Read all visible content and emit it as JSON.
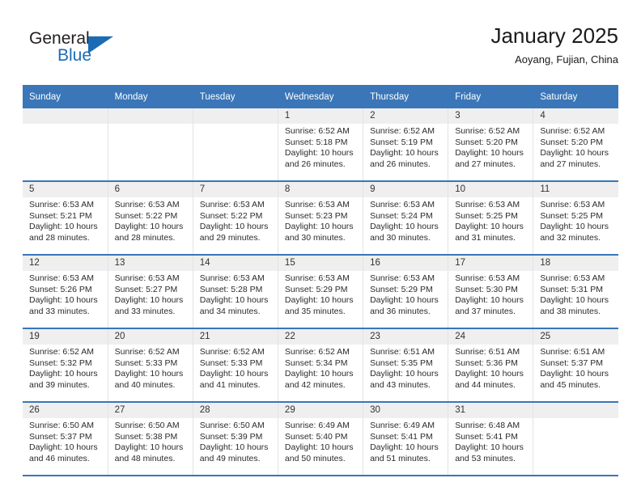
{
  "brand": {
    "name_part1": "General",
    "name_part2": "Blue",
    "triangle_icon": "triangle-icon",
    "accent_color": "#1b6cb5"
  },
  "header": {
    "title": "January 2025",
    "location": "Aoyang, Fujian, China"
  },
  "theme": {
    "header_blue": "#3a76b8",
    "daynum_band": "#efefef",
    "text": "#2b2b2b"
  },
  "weekdays": [
    "Sunday",
    "Monday",
    "Tuesday",
    "Wednesday",
    "Thursday",
    "Friday",
    "Saturday"
  ],
  "weeks": [
    [
      {
        "day": "",
        "empty": true
      },
      {
        "day": "",
        "empty": true
      },
      {
        "day": "",
        "empty": true
      },
      {
        "day": "1",
        "sunrise": "Sunrise: 6:52 AM",
        "sunset": "Sunset: 5:18 PM",
        "daylight1": "Daylight: 10 hours",
        "daylight2": "and 26 minutes."
      },
      {
        "day": "2",
        "sunrise": "Sunrise: 6:52 AM",
        "sunset": "Sunset: 5:19 PM",
        "daylight1": "Daylight: 10 hours",
        "daylight2": "and 26 minutes."
      },
      {
        "day": "3",
        "sunrise": "Sunrise: 6:52 AM",
        "sunset": "Sunset: 5:20 PM",
        "daylight1": "Daylight: 10 hours",
        "daylight2": "and 27 minutes."
      },
      {
        "day": "4",
        "sunrise": "Sunrise: 6:52 AM",
        "sunset": "Sunset: 5:20 PM",
        "daylight1": "Daylight: 10 hours",
        "daylight2": "and 27 minutes."
      }
    ],
    [
      {
        "day": "5",
        "sunrise": "Sunrise: 6:53 AM",
        "sunset": "Sunset: 5:21 PM",
        "daylight1": "Daylight: 10 hours",
        "daylight2": "and 28 minutes."
      },
      {
        "day": "6",
        "sunrise": "Sunrise: 6:53 AM",
        "sunset": "Sunset: 5:22 PM",
        "daylight1": "Daylight: 10 hours",
        "daylight2": "and 28 minutes."
      },
      {
        "day": "7",
        "sunrise": "Sunrise: 6:53 AM",
        "sunset": "Sunset: 5:22 PM",
        "daylight1": "Daylight: 10 hours",
        "daylight2": "and 29 minutes."
      },
      {
        "day": "8",
        "sunrise": "Sunrise: 6:53 AM",
        "sunset": "Sunset: 5:23 PM",
        "daylight1": "Daylight: 10 hours",
        "daylight2": "and 30 minutes."
      },
      {
        "day": "9",
        "sunrise": "Sunrise: 6:53 AM",
        "sunset": "Sunset: 5:24 PM",
        "daylight1": "Daylight: 10 hours",
        "daylight2": "and 30 minutes."
      },
      {
        "day": "10",
        "sunrise": "Sunrise: 6:53 AM",
        "sunset": "Sunset: 5:25 PM",
        "daylight1": "Daylight: 10 hours",
        "daylight2": "and 31 minutes."
      },
      {
        "day": "11",
        "sunrise": "Sunrise: 6:53 AM",
        "sunset": "Sunset: 5:25 PM",
        "daylight1": "Daylight: 10 hours",
        "daylight2": "and 32 minutes."
      }
    ],
    [
      {
        "day": "12",
        "sunrise": "Sunrise: 6:53 AM",
        "sunset": "Sunset: 5:26 PM",
        "daylight1": "Daylight: 10 hours",
        "daylight2": "and 33 minutes."
      },
      {
        "day": "13",
        "sunrise": "Sunrise: 6:53 AM",
        "sunset": "Sunset: 5:27 PM",
        "daylight1": "Daylight: 10 hours",
        "daylight2": "and 33 minutes."
      },
      {
        "day": "14",
        "sunrise": "Sunrise: 6:53 AM",
        "sunset": "Sunset: 5:28 PM",
        "daylight1": "Daylight: 10 hours",
        "daylight2": "and 34 minutes."
      },
      {
        "day": "15",
        "sunrise": "Sunrise: 6:53 AM",
        "sunset": "Sunset: 5:29 PM",
        "daylight1": "Daylight: 10 hours",
        "daylight2": "and 35 minutes."
      },
      {
        "day": "16",
        "sunrise": "Sunrise: 6:53 AM",
        "sunset": "Sunset: 5:29 PM",
        "daylight1": "Daylight: 10 hours",
        "daylight2": "and 36 minutes."
      },
      {
        "day": "17",
        "sunrise": "Sunrise: 6:53 AM",
        "sunset": "Sunset: 5:30 PM",
        "daylight1": "Daylight: 10 hours",
        "daylight2": "and 37 minutes."
      },
      {
        "day": "18",
        "sunrise": "Sunrise: 6:53 AM",
        "sunset": "Sunset: 5:31 PM",
        "daylight1": "Daylight: 10 hours",
        "daylight2": "and 38 minutes."
      }
    ],
    [
      {
        "day": "19",
        "sunrise": "Sunrise: 6:52 AM",
        "sunset": "Sunset: 5:32 PM",
        "daylight1": "Daylight: 10 hours",
        "daylight2": "and 39 minutes."
      },
      {
        "day": "20",
        "sunrise": "Sunrise: 6:52 AM",
        "sunset": "Sunset: 5:33 PM",
        "daylight1": "Daylight: 10 hours",
        "daylight2": "and 40 minutes."
      },
      {
        "day": "21",
        "sunrise": "Sunrise: 6:52 AM",
        "sunset": "Sunset: 5:33 PM",
        "daylight1": "Daylight: 10 hours",
        "daylight2": "and 41 minutes."
      },
      {
        "day": "22",
        "sunrise": "Sunrise: 6:52 AM",
        "sunset": "Sunset: 5:34 PM",
        "daylight1": "Daylight: 10 hours",
        "daylight2": "and 42 minutes."
      },
      {
        "day": "23",
        "sunrise": "Sunrise: 6:51 AM",
        "sunset": "Sunset: 5:35 PM",
        "daylight1": "Daylight: 10 hours",
        "daylight2": "and 43 minutes."
      },
      {
        "day": "24",
        "sunrise": "Sunrise: 6:51 AM",
        "sunset": "Sunset: 5:36 PM",
        "daylight1": "Daylight: 10 hours",
        "daylight2": "and 44 minutes."
      },
      {
        "day": "25",
        "sunrise": "Sunrise: 6:51 AM",
        "sunset": "Sunset: 5:37 PM",
        "daylight1": "Daylight: 10 hours",
        "daylight2": "and 45 minutes."
      }
    ],
    [
      {
        "day": "26",
        "sunrise": "Sunrise: 6:50 AM",
        "sunset": "Sunset: 5:37 PM",
        "daylight1": "Daylight: 10 hours",
        "daylight2": "and 46 minutes."
      },
      {
        "day": "27",
        "sunrise": "Sunrise: 6:50 AM",
        "sunset": "Sunset: 5:38 PM",
        "daylight1": "Daylight: 10 hours",
        "daylight2": "and 48 minutes."
      },
      {
        "day": "28",
        "sunrise": "Sunrise: 6:50 AM",
        "sunset": "Sunset: 5:39 PM",
        "daylight1": "Daylight: 10 hours",
        "daylight2": "and 49 minutes."
      },
      {
        "day": "29",
        "sunrise": "Sunrise: 6:49 AM",
        "sunset": "Sunset: 5:40 PM",
        "daylight1": "Daylight: 10 hours",
        "daylight2": "and 50 minutes."
      },
      {
        "day": "30",
        "sunrise": "Sunrise: 6:49 AM",
        "sunset": "Sunset: 5:41 PM",
        "daylight1": "Daylight: 10 hours",
        "daylight2": "and 51 minutes."
      },
      {
        "day": "31",
        "sunrise": "Sunrise: 6:48 AM",
        "sunset": "Sunset: 5:41 PM",
        "daylight1": "Daylight: 10 hours",
        "daylight2": "and 53 minutes."
      },
      {
        "day": "",
        "empty": true
      }
    ]
  ]
}
